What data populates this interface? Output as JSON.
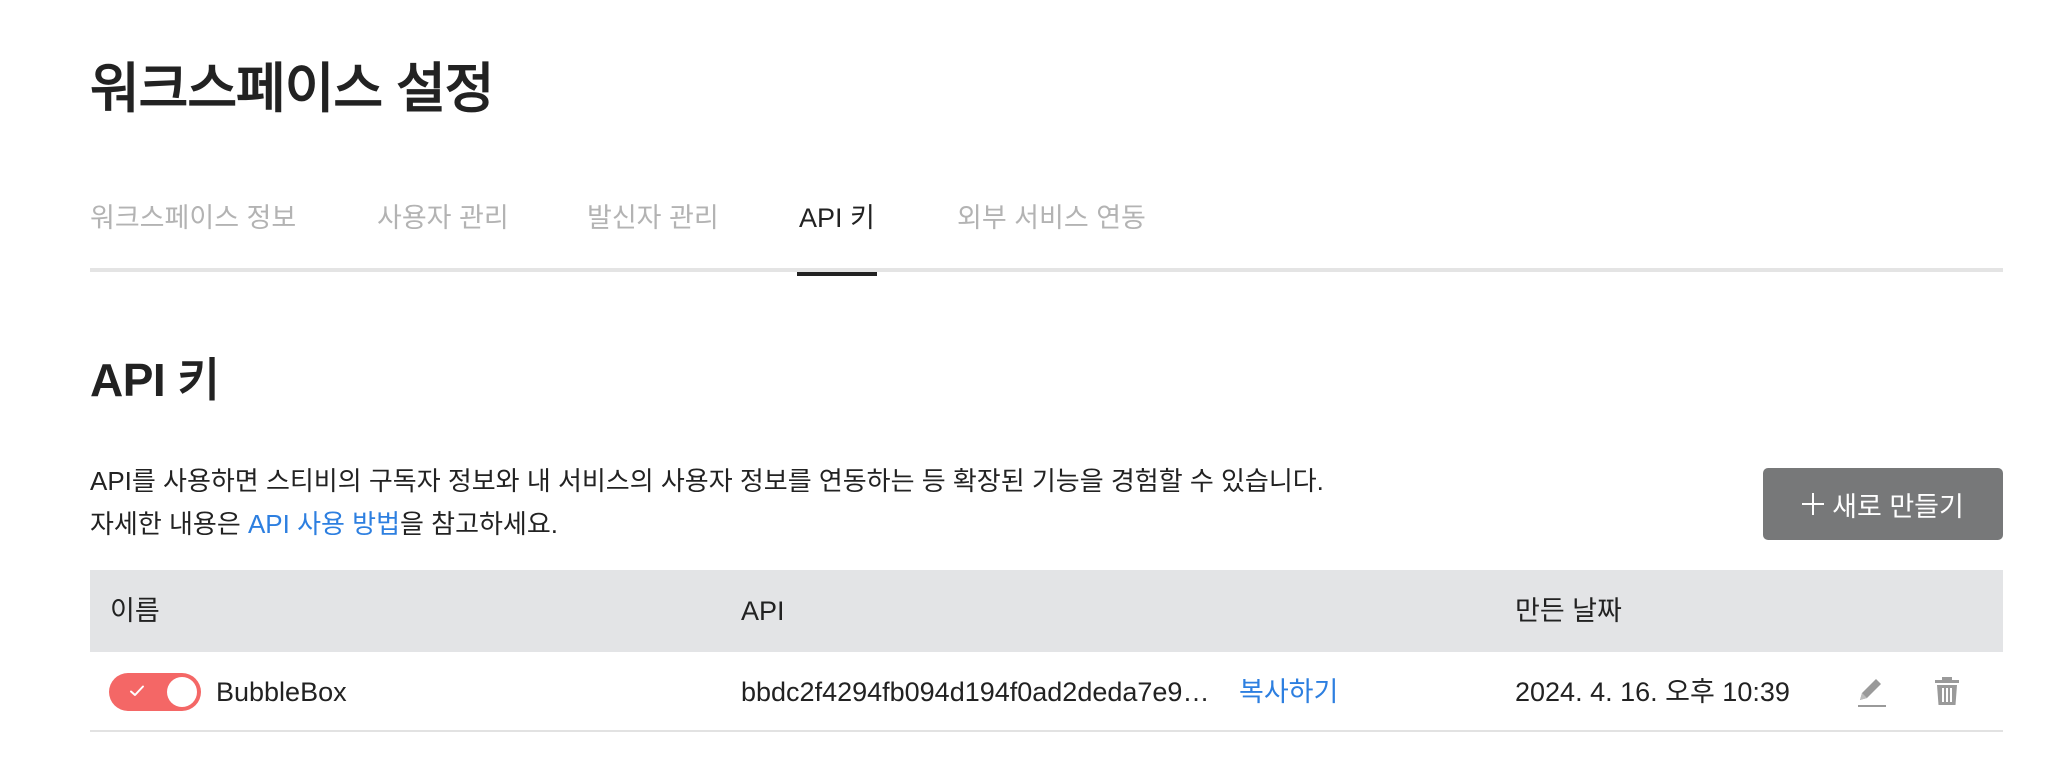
{
  "header": {
    "title": "워크스페이스 설정"
  },
  "tabs": [
    {
      "label": "워크스페이스 정보",
      "active": false
    },
    {
      "label": "사용자 관리",
      "active": false
    },
    {
      "label": "발신자 관리",
      "active": false
    },
    {
      "label": "API 키",
      "active": true
    },
    {
      "label": "외부 서비스 연동",
      "active": false
    }
  ],
  "section": {
    "title": "API 키",
    "description_line1": "API를 사용하면 스티비의 구독자 정보와 내 서비스의 사용자 정보를 연동하는 등 확장된 기능을 경험할 수 있습니다.",
    "description_line2_prefix": "자세한 내용은 ",
    "description_line2_link": "API 사용 방법",
    "description_line2_suffix": "을 참고하세요.",
    "create_button_label": "새로 만들기",
    "create_button_icon": "plus-icon"
  },
  "table": {
    "columns": {
      "name": "이름",
      "api": "API",
      "created": "만든 날짜"
    },
    "rows": [
      {
        "enabled": true,
        "name": "BubbleBox",
        "api_key": "bbdc2f4294fb094d194f0ad2deda7e9…",
        "copy_label": "복사하기",
        "created": "2024. 4. 16. 오후 10:39",
        "edit_icon": "pencil-icon",
        "delete_icon": "trash-icon"
      }
    ]
  },
  "colors": {
    "accent_link": "#2d7fe0",
    "toggle_on": "#f46766",
    "button_bg": "#777879",
    "table_header_bg": "#e3e4e6"
  }
}
